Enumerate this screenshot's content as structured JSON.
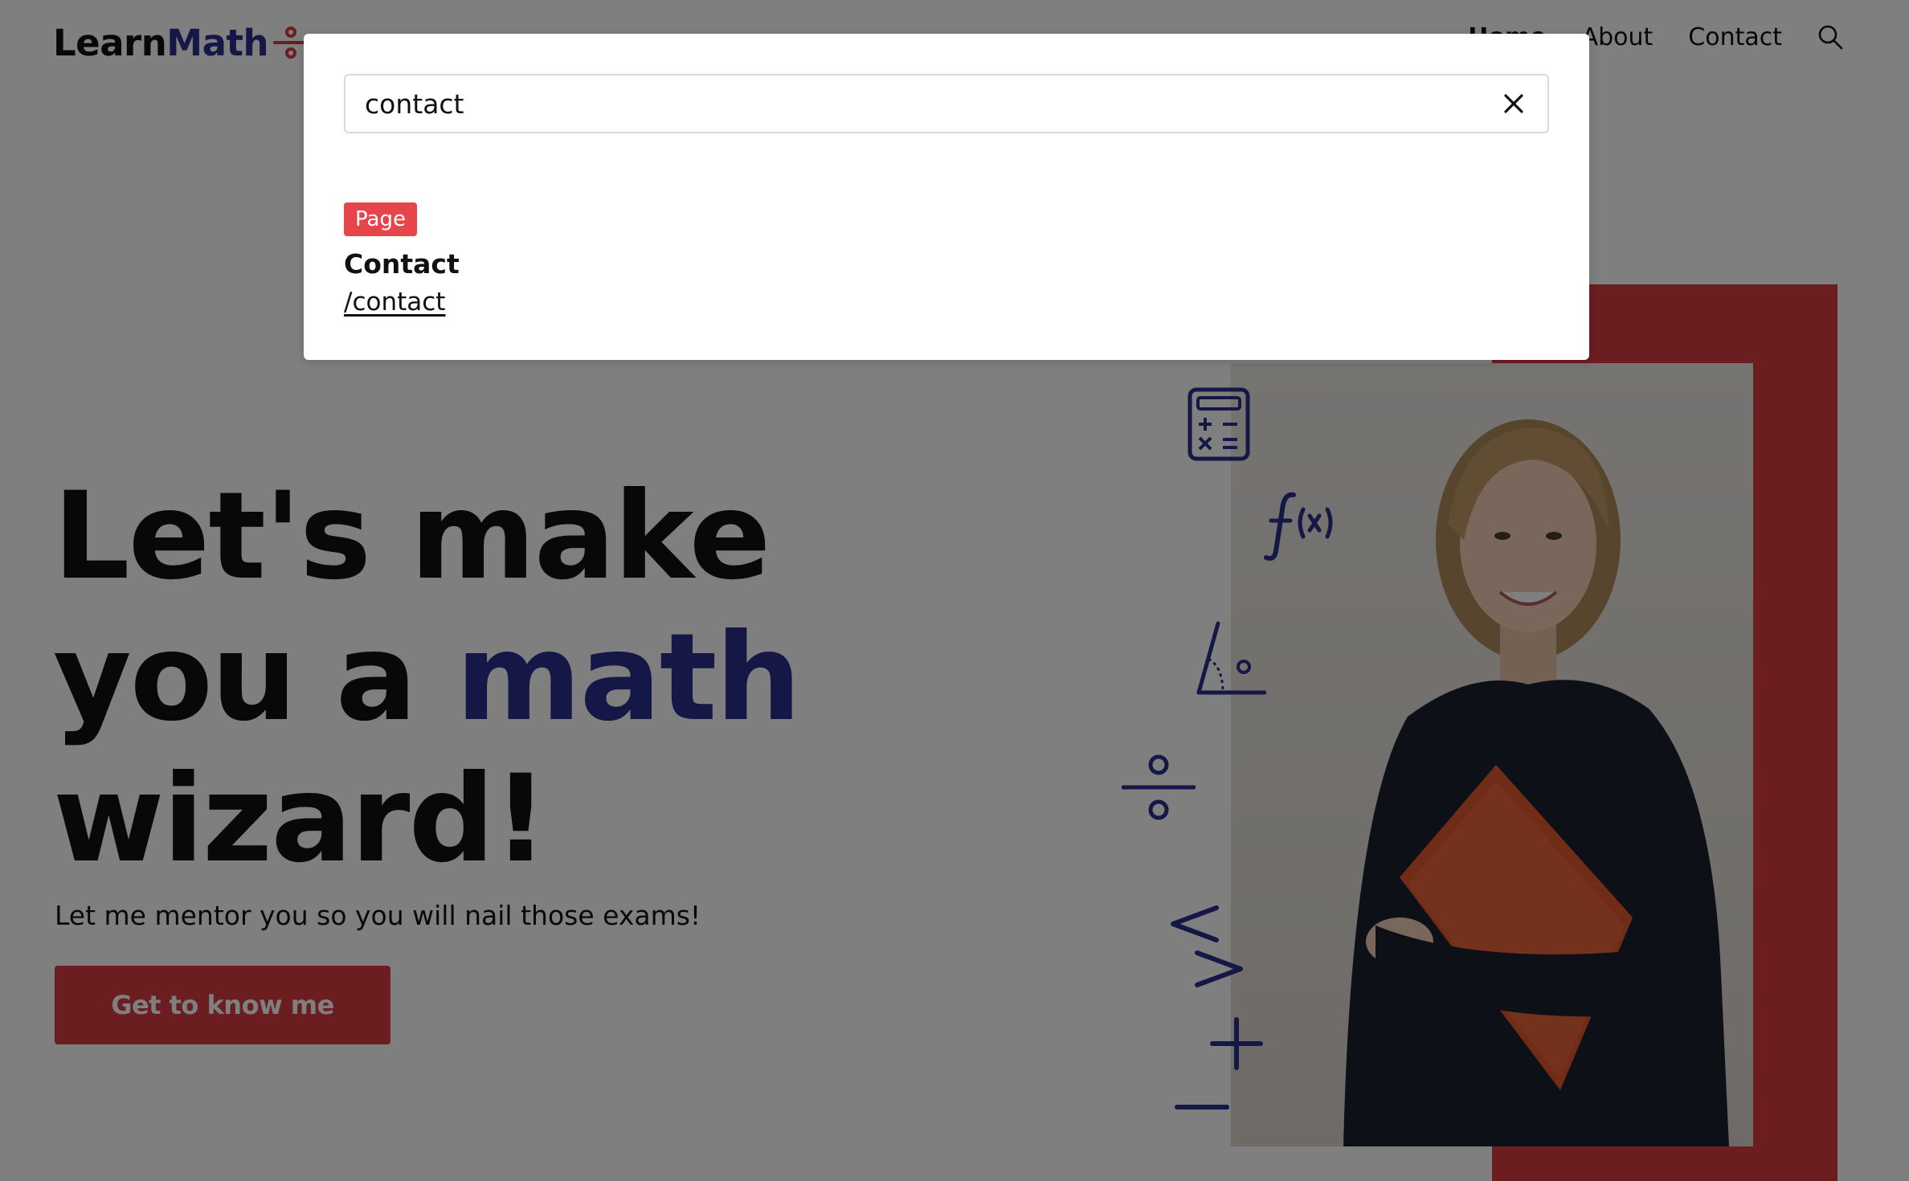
{
  "header": {
    "logo": {
      "part1": "Learn",
      "part2": "Math"
    },
    "nav": [
      {
        "label": "Home"
      },
      {
        "label": "About"
      },
      {
        "label": "Contact"
      }
    ]
  },
  "hero": {
    "title_line1": "Let's make",
    "title_line2_a": "you a ",
    "title_line2_b": "math",
    "title_line3": "wizard!",
    "subtitle": "Let me mentor you so you will nail those exams!",
    "cta_label": "Get to know me"
  },
  "search_modal": {
    "query": "contact",
    "results": [
      {
        "badge": "Page",
        "title": "Contact",
        "url": "/contact"
      }
    ]
  },
  "colors": {
    "brand_blue": "#2b2e8f",
    "brand_red": "#d63a41",
    "badge_red": "#e8444c"
  }
}
